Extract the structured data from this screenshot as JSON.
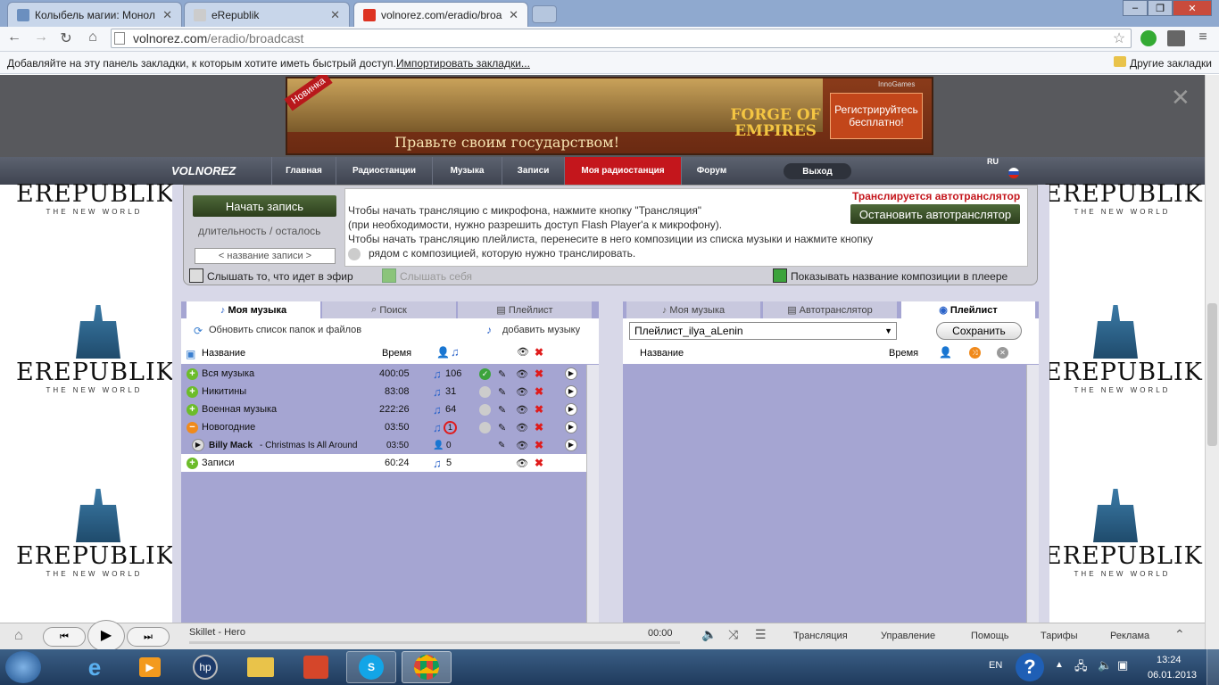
{
  "browser": {
    "tabs": [
      {
        "title": "Колыбель магии: Монол"
      },
      {
        "title": "eRepublik"
      },
      {
        "title": "volnorez.com/eradio/broa"
      }
    ],
    "url_host": "volnorez.com",
    "url_path": "/eradio/broadcast",
    "bookmarks_prompt": "Добавляйте на эту панель закладки, к которым хотите иметь быстрый доступ.",
    "import_link": "Импортировать закладки...",
    "other_bookmarks": "Другие закладки"
  },
  "ad": {
    "badge": "Новинка",
    "slogan": "Правьте своим государством!",
    "game": "FORGE OF EMPIRES",
    "brand": "InnoGames",
    "cta": "Регистрируйтесь бесплатно!"
  },
  "nav": {
    "logo": "VOLNOREZ",
    "items": [
      "Главная",
      "Радиостанции",
      "Музыка",
      "Записи",
      "Моя радиостанция",
      "Форум"
    ],
    "logout": "Выход",
    "lang": "RU"
  },
  "side_logo": {
    "word": "EREPUBLIK",
    "sub": "THE NEW WORLD"
  },
  "broadcast": {
    "start_record": "Начать запись",
    "duration": "длительность / осталось",
    "record_name": "< название записи >",
    "status": "Транслируется автотранслятор",
    "stop_auto": "Остановить автотранслятор",
    "info_line1": "Чтобы начать трансляцию с микрофона, нажмите кнопку \"Трансляция\"",
    "info_line2": "(при необходимости, нужно разрешить доступ Flash Player'а к микрофону).",
    "info_line3": "Чтобы начать трансляцию плейлиста, перенесите в него композиции из списка музыки и нажмите кнопку",
    "info_line4": "рядом с композицией, которую нужно транслировать.",
    "opt_listen_air": "Слышать то, что идет в эфир",
    "opt_listen_self": "Слышать себя",
    "opt_show_title": "Показывать название композиции в плеере"
  },
  "left_panel": {
    "tabs": [
      "Моя музыка",
      "Поиск",
      "Плейлист"
    ],
    "refresh": "Обновить список папок и файлов",
    "add_music": "добавить музыку",
    "col_name": "Название",
    "col_time": "Время",
    "rows": [
      {
        "name": "Вся музыка",
        "time": "400:05",
        "count": "106"
      },
      {
        "name": "Никитины",
        "time": "83:08",
        "count": "31"
      },
      {
        "name": "Военная музыка",
        "time": "222:26",
        "count": "64"
      },
      {
        "name": "Новогодние",
        "time": "03:50",
        "count": "1"
      }
    ],
    "track": {
      "artist": "Billy Mack",
      "title": " - Christmas Is All Around",
      "time": "03:50",
      "listeners": "0"
    },
    "records": {
      "name": "Записи",
      "time": "60:24",
      "count": "5"
    }
  },
  "right_panel": {
    "tabs": [
      "Моя музыка",
      "Автотранслятор",
      "Плейлист"
    ],
    "playlist_select": "Плейлист_ilya_aLenin",
    "save": "Сохранить",
    "col_name": "Название",
    "col_time": "Время"
  },
  "player": {
    "track": "Skillet - Hero",
    "time": "00:00",
    "links": [
      "Трансляция",
      "Управление",
      "Помощь",
      "Тарифы",
      "Реклама"
    ]
  },
  "taskbar": {
    "lang": "EN",
    "time": "13:24",
    "date": "06.01.2013"
  }
}
